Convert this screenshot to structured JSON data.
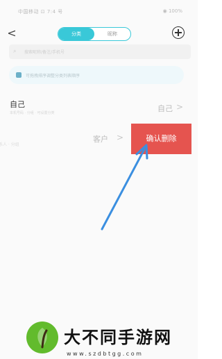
{
  "status_bar": {
    "left_text": "中国移动 ⊡ 7:4 号",
    "right_text": "◉ 100%"
  },
  "nav": {
    "back_label": "<",
    "tabs": [
      {
        "label": "分类",
        "active": true
      },
      {
        "label": "昵称",
        "active": false
      }
    ]
  },
  "search": {
    "placeholder": "搜索昵称/备注/手机号"
  },
  "notice": {
    "text": "可拖拽排序调整分类列表顺序"
  },
  "list": {
    "row_self": {
      "title": "自己",
      "subtitle": "本机号码 · 分组 · 可设置分类",
      "value": "自己",
      "chevron": ">"
    },
    "row_swipe": {
      "left_hint": "联系人 · 分组",
      "value": "客户",
      "chevron": ">",
      "delete_label": "确认删除"
    }
  },
  "annotation": {
    "color": "#3b8fe0"
  },
  "watermark": {
    "brand_text": "大不同手游网",
    "url": "www.szdbtgg.com",
    "logo_color": "#62bb2d"
  },
  "colors": {
    "accent": "#39c8d8",
    "delete": "#e5544f"
  }
}
